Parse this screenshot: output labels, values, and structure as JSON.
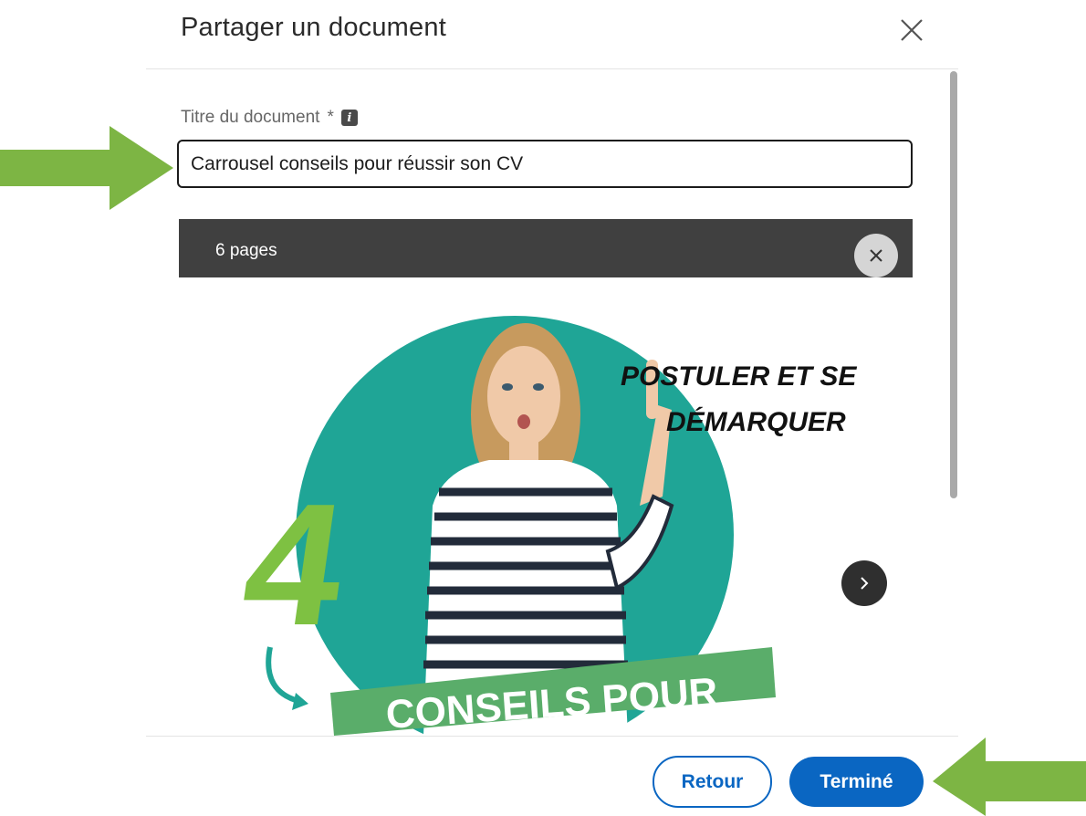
{
  "dialog": {
    "title": "Partager un document"
  },
  "form": {
    "title_label": "Titre du document",
    "required_mark": "*",
    "title_value": "Carrousel conseils pour réussir son CV"
  },
  "preview": {
    "page_count": "6 pages",
    "slide": {
      "headline_line1": "POSTULER ET SE",
      "headline_line2": "DÉMARQUER",
      "big_number": "4",
      "banner_text": "CONSEILS POUR"
    }
  },
  "footer": {
    "back_label": "Retour",
    "done_label": "Terminé"
  },
  "colors": {
    "accent": "#0a66c2",
    "annotation_arrow": "#7db544",
    "slide_teal": "#1fa596",
    "slide_green": "#7ec142",
    "banner_green": "#5aad6a"
  }
}
